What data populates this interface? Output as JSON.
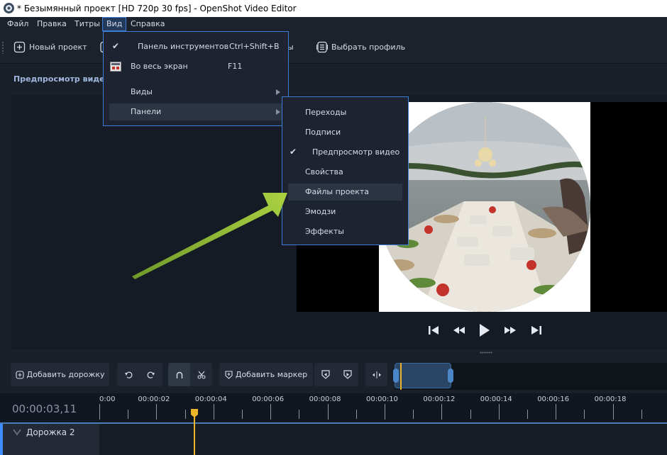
{
  "window": {
    "title": "* Безымянный проект [HD 720p 30 fps] - OpenShot Video Editor"
  },
  "menubar": {
    "items": [
      {
        "label": "Файл"
      },
      {
        "label": "Правка"
      },
      {
        "label": "Титры"
      },
      {
        "label": "Вид"
      },
      {
        "label": "Справка"
      }
    ]
  },
  "toolbar": {
    "new_project": "Новый проект",
    "partial_label": "ы",
    "choose_profile": "Выбрать профиль"
  },
  "preview": {
    "header": "Предпросмотр видео"
  },
  "view_menu": {
    "items": [
      {
        "label": "Панель инструментов",
        "shortcut": "Ctrl+Shift+B",
        "checked": true
      },
      {
        "label": "Во весь экран",
        "shortcut": "F11",
        "icon": "fullscreen-icon"
      },
      {
        "label": "Виды",
        "submenu": true
      },
      {
        "label": "Панели",
        "submenu": true
      }
    ]
  },
  "panels_submenu": {
    "items": [
      {
        "label": "Переходы"
      },
      {
        "label": "Подписи"
      },
      {
        "label": "Предпросмотр видео",
        "checked": true
      },
      {
        "label": "Свойства"
      },
      {
        "label": "Файлы проекта",
        "highlighted": true
      },
      {
        "label": "Эмодзи"
      },
      {
        "label": "Эффекты"
      }
    ]
  },
  "timeline_toolbar": {
    "add_track": "Добавить дорожку",
    "add_marker": "Добавить маркер"
  },
  "timeline": {
    "timecode": "00:00:03,11",
    "ticks": [
      "0:00",
      "00:00:02",
      "00:00:04",
      "00:00:06",
      "00:00:08",
      "00:00:10",
      "00:00:12",
      "00:00:14",
      "00:00:16",
      "00:00:18"
    ],
    "track_name": "Дорожка 2"
  },
  "colors": {
    "accent": "#3f7ed6",
    "playhead": "#f0b429",
    "arrow": "#9bc43a"
  }
}
